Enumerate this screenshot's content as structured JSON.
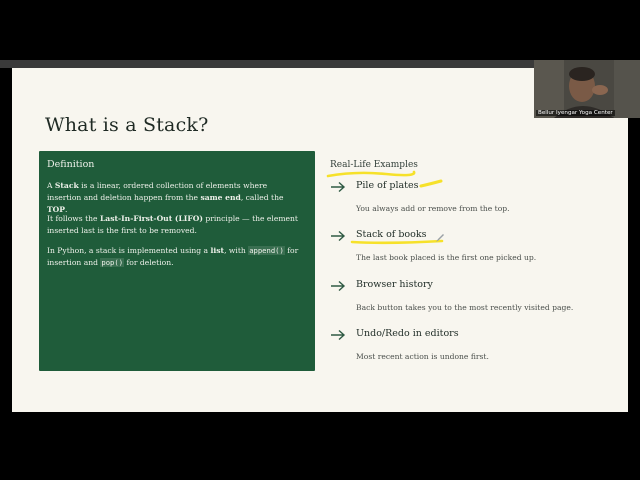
{
  "slide": {
    "title": "What is a Stack?",
    "definition": {
      "heading": "Definition",
      "p1": {
        "a": "A ",
        "b1": "Stack",
        "c": " is a linear, ordered collection of elements where insertion and deletion happen from the ",
        "b2": "same end",
        "d": ", called the ",
        "b3": "TOP",
        "e": "."
      },
      "p2": {
        "a": "It follows the ",
        "b1": "Last-In-First-Out (LIFO)",
        "c": " principle — the element inserted last is the first to be removed."
      },
      "p3": {
        "a": "In Python, a stack is implemented using a ",
        "b1": "list",
        "c": ", with ",
        "code1": "append()",
        "d": " for insertion and ",
        "code2": "pop()",
        "e": " for deletion."
      }
    },
    "examples": {
      "heading": "Real-Life Examples",
      "items": [
        {
          "title": "Pile of plates",
          "desc": "You always add or remove from the top."
        },
        {
          "title": "Stack of books",
          "desc": "The last book placed is the first one picked up."
        },
        {
          "title": "Browser history",
          "desc": "Back button takes you to the most recently visited page."
        },
        {
          "title": "Undo/Redo in editors",
          "desc": "Most recent action is undone first."
        }
      ]
    },
    "colors": {
      "definition_bg": "#1f5c3a",
      "slide_bg": "#f8f6ef",
      "highlight": "#f6e12a"
    }
  },
  "webcam": {
    "label": "Bellur Iyengar Yoga Center"
  }
}
